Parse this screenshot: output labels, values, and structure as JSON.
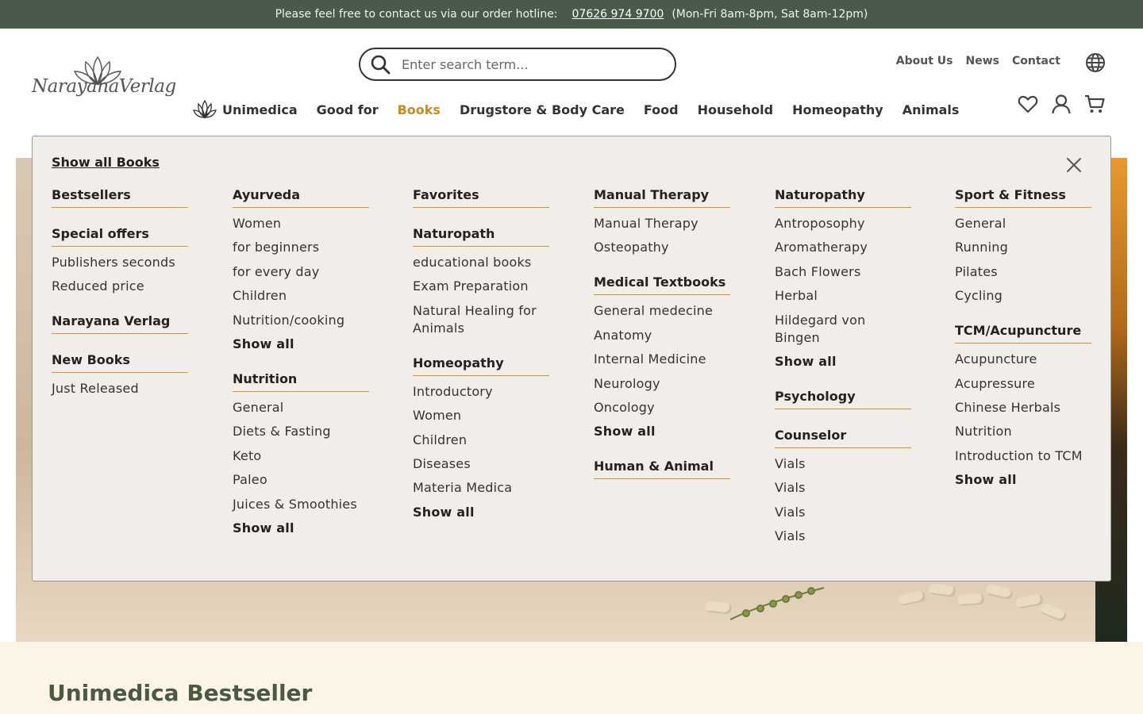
{
  "topbar": {
    "text": "Please feel free to contact us via our order hotline:",
    "phone": "07626 974 9700",
    "hours": "(Mon-Fri 8am-8pm, Sat 8am-12pm)"
  },
  "logo": {
    "text": "NarayanaVerlag"
  },
  "search": {
    "placeholder": "Enter search term..."
  },
  "toplinks": [
    "About Us",
    "News",
    "Contact"
  ],
  "nav": [
    "Unimedica",
    "Good for",
    "Books",
    "Drugstore & Body Care",
    "Food",
    "Household",
    "Homeopathy",
    "Animals"
  ],
  "mega": {
    "show_all": "Show all Books",
    "columns": [
      [
        {
          "title": "Bestsellers",
          "items": []
        },
        {
          "title": "Special offers",
          "items": [
            "Publishers seconds",
            "Reduced price"
          ]
        },
        {
          "title": "Narayana Verlag",
          "items": []
        },
        {
          "title": "New Books",
          "items": [
            "Just Released"
          ]
        }
      ],
      [
        {
          "title": "Ayurveda",
          "items": [
            "Women",
            "for beginners",
            "for every day",
            "Children",
            "Nutrition/cooking",
            "Show all"
          ]
        },
        {
          "title": "Nutrition",
          "items": [
            "General",
            "Diets & Fasting",
            "Keto",
            "Paleo",
            "Juices & Smoothies",
            "Show all"
          ]
        }
      ],
      [
        {
          "title": "Favorites",
          "items": []
        },
        {
          "title": "Naturopath",
          "items": [
            "educational books",
            "Exam Preparation",
            "Natural Healing for Animals"
          ]
        },
        {
          "title": "Homeopathy",
          "items": [
            "Introductory",
            "Women",
            "Children",
            "Diseases",
            "Materia Medica",
            "Show all"
          ]
        }
      ],
      [
        {
          "title": "Manual Therapy",
          "items": [
            "Manual Therapy",
            "Osteopathy"
          ]
        },
        {
          "title": "Medical Textbooks",
          "items": [
            "General medecine",
            "Anatomy",
            "Internal Medicine",
            "Neurology",
            "Oncology",
            "Show all"
          ]
        },
        {
          "title": "Human & Animal",
          "items": []
        }
      ],
      [
        {
          "title": "Naturopathy",
          "items": [
            "Antroposophy",
            "Aromatherapy",
            "Bach Flowers",
            "Herbal",
            "Hildegard von Bingen",
            "Show all"
          ]
        },
        {
          "title": "Psychology",
          "items": []
        },
        {
          "title": "Counselor",
          "items": [
            "Vials",
            "Vials",
            "Vials",
            "Vials"
          ]
        }
      ],
      [
        {
          "title": "Sport & Fitness",
          "items": [
            "General",
            "Running",
            "Pilates",
            "Cycling"
          ]
        },
        {
          "title": "TCM/Acupuncture",
          "items": [
            "Acupuncture",
            "Acupressure",
            "Chinese Herbals",
            "Nutrition",
            "Introduction to TCM",
            "Show all"
          ]
        }
      ]
    ]
  },
  "section": {
    "title": "Unimedica Bestseller"
  },
  "icons": [
    "wishlist-icon",
    "account-icon",
    "cart-icon",
    "globe-icon",
    "search-icon",
    "close-icon",
    "lotus-icon"
  ],
  "colors": {
    "topbar": "#4a5a4a",
    "accent": "#c98a1e",
    "section_title": "#4a5a3e",
    "mega_bg": "#f1eeea"
  }
}
